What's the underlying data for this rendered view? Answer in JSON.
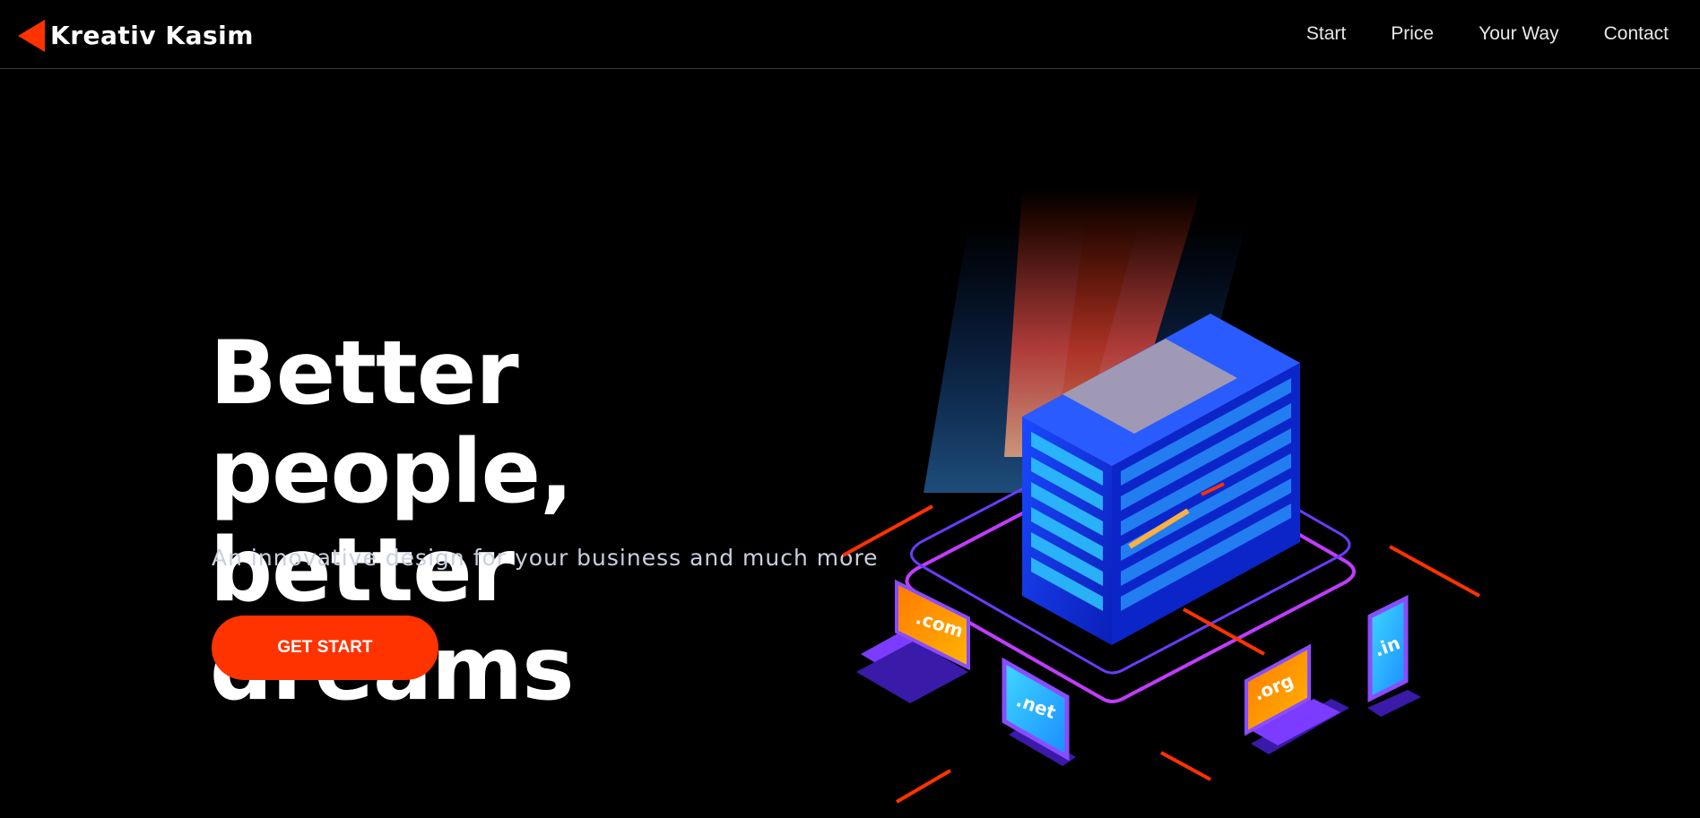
{
  "brand": {
    "name": "Kreativ Kasim",
    "accent_color": "#ff3300",
    "logo_icon": "triangle-left-icon"
  },
  "nav": {
    "items": [
      {
        "label": "Start"
      },
      {
        "label": "Price"
      },
      {
        "label": "Your Way"
      },
      {
        "label": "Contact"
      }
    ]
  },
  "hero": {
    "title_line1": "Better people,",
    "title_line2": "better dreams",
    "subtitle": "An innovative design for your business and much more",
    "cta_label": "GET START"
  },
  "illustration": {
    "name": "isometric-server-illustration",
    "domains": [
      ".com",
      ".net",
      ".org",
      ".in"
    ]
  }
}
